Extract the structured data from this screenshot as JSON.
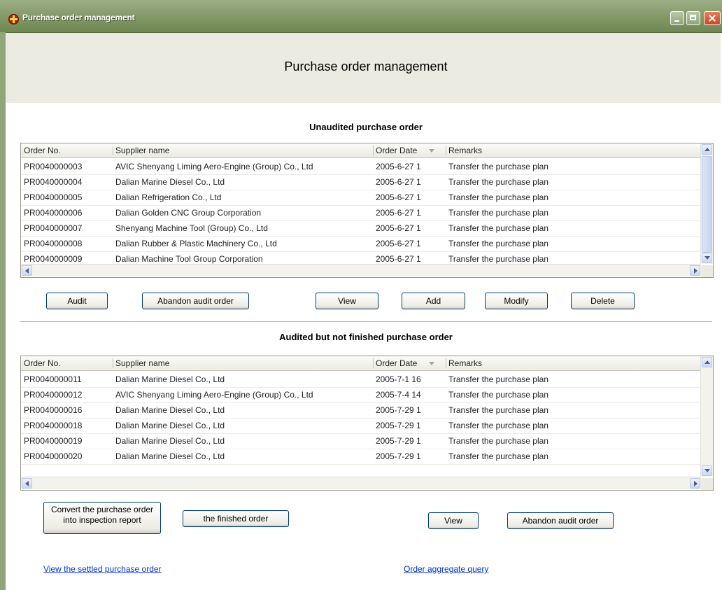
{
  "window": {
    "title": "Purchase order management"
  },
  "page_title": "Purchase order management",
  "unaudited": {
    "title": "Unaudited purchase order",
    "columns": [
      "Order No.",
      "Supplier name",
      "Order Date",
      "Remarks"
    ],
    "rows": [
      [
        "PR0040000003",
        "AVIC Shenyang Liming Aero-Engine (Group) Co., Ltd",
        "2005-6-27 1",
        "Transfer the purchase plan"
      ],
      [
        "PR0040000004",
        "Dalian Marine Diesel Co., Ltd",
        "2005-6-27 1",
        "Transfer the purchase plan"
      ],
      [
        "PR0040000005",
        "Dalian Refrigeration Co., Ltd",
        "2005-6-27 1",
        "Transfer the purchase plan"
      ],
      [
        "PR0040000006",
        "Dalian Golden CNC Group Corporation",
        "2005-6-27 1",
        "Transfer the purchase plan"
      ],
      [
        "PR0040000007",
        "Shenyang Machine Tool (Group) Co., Ltd",
        "2005-6-27 1",
        "Transfer the purchase plan"
      ],
      [
        "PR0040000008",
        "Dalian Rubber & Plastic Machinery Co., Ltd",
        "2005-6-27 1",
        "Transfer the purchase plan"
      ],
      [
        "PR0040000009",
        "Dalian Machine Tool Group Corporation",
        "2005-6-27 1",
        "Transfer the purchase plan"
      ]
    ],
    "buttons": {
      "audit": "Audit",
      "abandon": "Abandon audit order",
      "view": "View",
      "add": "Add",
      "modify": "Modify",
      "delete": "Delete"
    }
  },
  "audited": {
    "title": "Audited but not finished purchase order",
    "columns": [
      "Order No.",
      "Supplier name",
      "Order Date",
      "Remarks"
    ],
    "rows": [
      [
        "PR0040000011",
        "Dalian Marine Diesel Co., Ltd",
        "2005-7-1 16",
        "Transfer the purchase plan"
      ],
      [
        "PR0040000012",
        "AVIC Shenyang Liming Aero-Engine (Group) Co., Ltd",
        "2005-7-4 14",
        "Transfer the purchase plan"
      ],
      [
        "PR0040000016",
        "Dalian Marine Diesel Co., Ltd",
        "2005-7-29 1",
        "Transfer the purchase plan"
      ],
      [
        "PR0040000018",
        "Dalian Marine Diesel Co., Ltd",
        "2005-7-29 1",
        "Transfer the purchase plan"
      ],
      [
        "PR0040000019",
        "Dalian Marine Diesel Co., Ltd",
        "2005-7-29 1",
        "Transfer the purchase plan"
      ],
      [
        "PR0040000020",
        "Dalian Marine Diesel Co., Ltd",
        "2005-7-29 1",
        "Transfer the purchase plan"
      ]
    ],
    "buttons": {
      "convert_line1": "Convert the purchase order",
      "convert_line2": "into inspection report",
      "finished": "the finished order",
      "view": "View",
      "abandon": "Abandon audit order"
    }
  },
  "links": {
    "settled": "View the settled purchase order",
    "aggregate": "Order aggregate query"
  },
  "colors": {
    "title_bar": "#7f9663",
    "header_band": "#ecebe2",
    "link": "#0033cc"
  }
}
